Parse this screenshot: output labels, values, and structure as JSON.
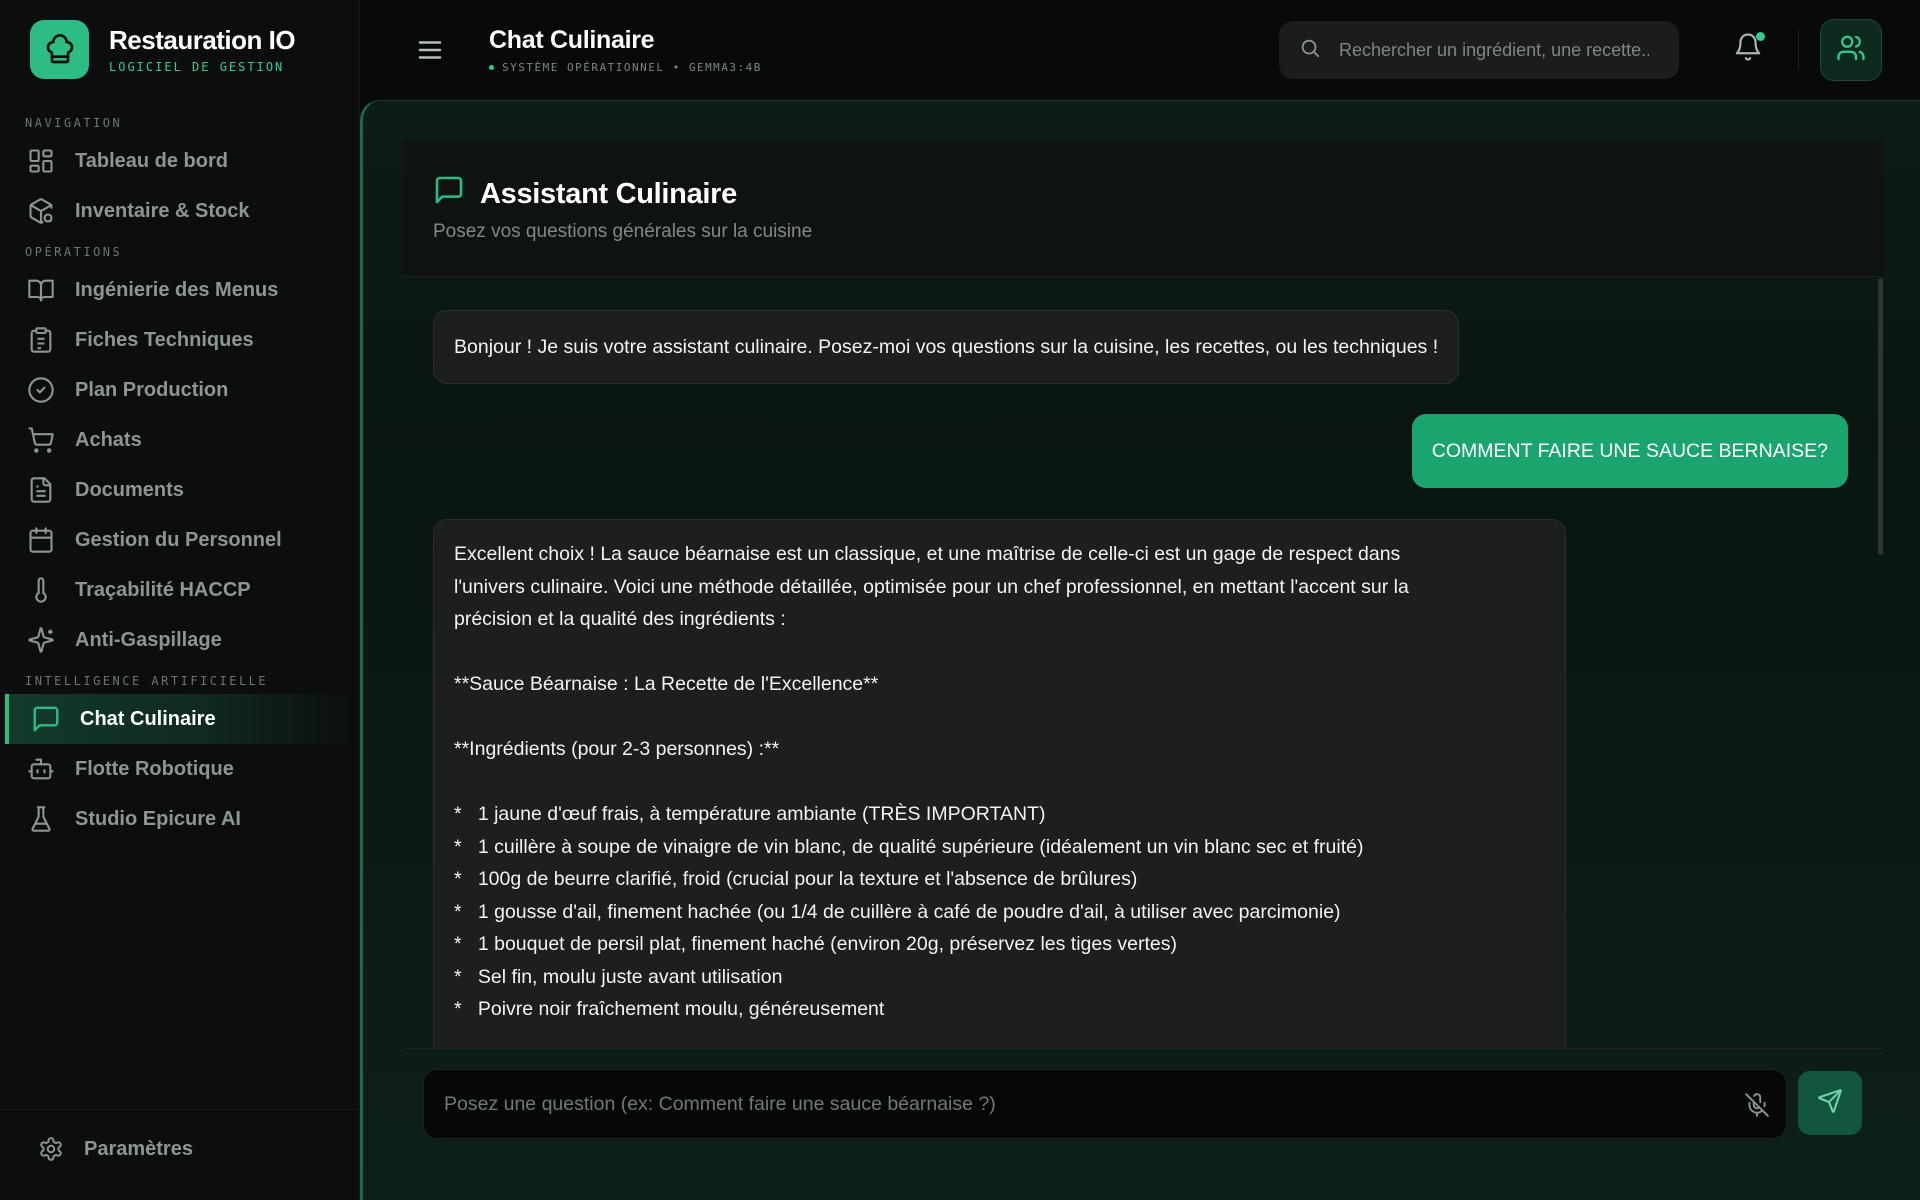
{
  "brand": {
    "name": "Restauration IO",
    "subtitle": "LOGICIEL DE GESTION"
  },
  "sidebar": {
    "sections": [
      "NAVIGATION",
      "OPÉRATIONS",
      "INTELLIGENCE ARTIFICIELLE"
    ],
    "items": [
      {
        "label": "Tableau de bord",
        "icon": "dashboard-icon"
      },
      {
        "label": "Inventaire & Stock",
        "icon": "package-search-icon"
      },
      {
        "label": "Ingénierie des Menus",
        "icon": "book-open-icon"
      },
      {
        "label": "Fiches Techniques",
        "icon": "clipboard-icon"
      },
      {
        "label": "Plan Production",
        "icon": "check-circle-icon"
      },
      {
        "label": "Achats",
        "icon": "cart-icon"
      },
      {
        "label": "Documents",
        "icon": "file-icon"
      },
      {
        "label": "Gestion du Personnel",
        "icon": "calendar-icon"
      },
      {
        "label": "Traçabilité HACCP",
        "icon": "thermometer-icon"
      },
      {
        "label": "Anti-Gaspillage",
        "icon": "sparkles-icon"
      },
      {
        "label": "Chat Culinaire",
        "icon": "chat-icon",
        "active": true
      },
      {
        "label": "Flotte Robotique",
        "icon": "robot-icon"
      },
      {
        "label": "Studio Epicure AI",
        "icon": "flask-icon"
      }
    ],
    "settings_label": "Paramètres"
  },
  "header": {
    "title": "Chat Culinaire",
    "status": "SYSTÈME OPÉRATIONNEL • GEMMA3:4B",
    "search_placeholder": "Rechercher un ingrédient, une recette..."
  },
  "chat": {
    "title": "Assistant Culinaire",
    "subtitle": "Posez vos questions générales sur la cuisine",
    "messages": [
      {
        "role": "assistant",
        "text": "Bonjour ! Je suis votre assistant culinaire. Posez-moi vos questions sur la cuisine, les recettes, ou les techniques !"
      },
      {
        "role": "user",
        "text": "COMMENT FAIRE UNE SAUCE BERNAISE?"
      },
      {
        "role": "assistant",
        "lines": [
          "Excellent choix ! La sauce béarnaise est un classique, et une maîtrise de celle-ci est un gage de respect dans",
          "l'univers culinaire. Voici une méthode détaillée, optimisée pour un chef professionnel, en mettant l'accent sur la",
          "précision et la qualité des ingrédients :",
          "",
          "**Sauce Béarnaise : La Recette de l'Excellence**",
          "",
          "**Ingrédients (pour 2-3 personnes) :**",
          "",
          "*   1 jaune d'œuf frais, à température ambiante (TRÈS IMPORTANT)",
          "*   1 cuillère à soupe de vinaigre de vin blanc, de qualité supérieure (idéalement un vin blanc sec et fruité)",
          "*   100g de beurre clarifié, froid (crucial pour la texture et l'absence de brûlures)",
          "*   1 gousse d'ail, finement hachée (ou 1/4 de cuillère à café de poudre d'ail, à utiliser avec parcimonie)",
          "*   1 bouquet de persil plat, finement haché (environ 20g, préservez les tiges vertes)",
          "*   Sel fin, moulu juste avant utilisation",
          "*   Poivre noir fraîchement moulu, généreusement"
        ]
      }
    ],
    "input_placeholder": "Posez une question (ex: Comment faire une sauce béarnaise ?)"
  },
  "colors": {
    "accent": "#2bbd84",
    "user_bubble": "#1ba56e",
    "background": "#07090a"
  }
}
